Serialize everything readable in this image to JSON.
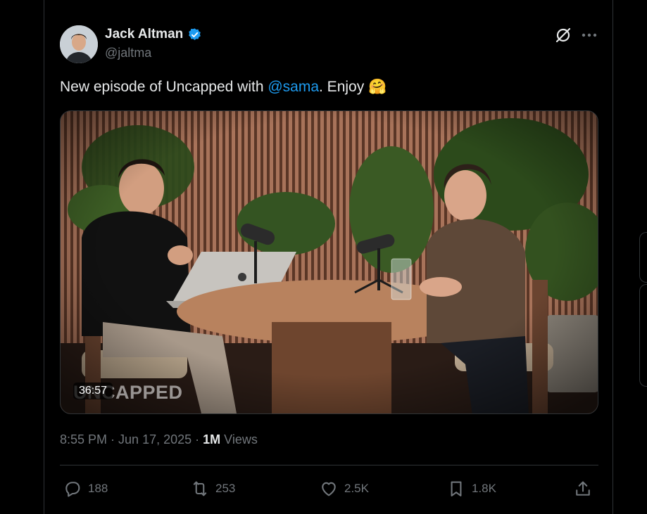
{
  "author": {
    "name": "Jack Altman",
    "handle": "@jaltma",
    "verified_color": "#1d9bf0"
  },
  "post": {
    "text_before": "New episode of Uncapped with ",
    "mention": "@sama",
    "text_after": ". Enjoy ",
    "emoji": "🤗"
  },
  "media": {
    "duration": "36:57",
    "watermark": "UNCAPPED"
  },
  "meta": {
    "time": "8:55 PM",
    "separator": " · ",
    "date": "Jun 17, 2025",
    "views_count": "1M",
    "views_label": " Views"
  },
  "actions": {
    "replies": "188",
    "reposts": "253",
    "likes": "2.5K",
    "bookmarks": "1.8K"
  },
  "icons": {
    "grok": "grok-icon",
    "more": "more-icon",
    "reply": "reply-icon",
    "repost": "repost-icon",
    "like": "heart-icon",
    "bookmark": "bookmark-icon",
    "share": "share-icon"
  },
  "colors": {
    "background": "#000000",
    "text": "#e7e9ea",
    "secondary": "#71767b",
    "accent": "#1d9bf0",
    "border": "#2f3336"
  }
}
